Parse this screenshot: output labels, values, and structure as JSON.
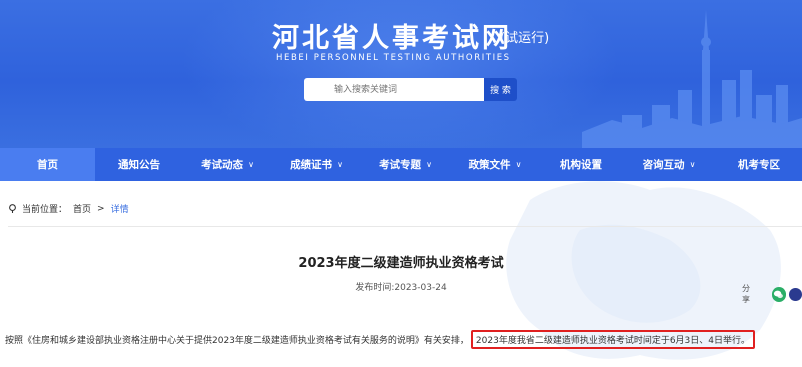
{
  "header": {
    "title": "河北省人事考试网",
    "title_suffix": "(试运行)",
    "subtitle_en": "HEBEI PERSONNEL TESTING AUTHORITIES"
  },
  "search": {
    "placeholder": "输入搜索关键词",
    "button_label": "搜 索"
  },
  "nav": {
    "items": [
      {
        "label": "首页",
        "has_dropdown": false,
        "active": true
      },
      {
        "label": "通知公告",
        "has_dropdown": false,
        "active": false
      },
      {
        "label": "考试动态",
        "has_dropdown": true,
        "active": false
      },
      {
        "label": "成绩证书",
        "has_dropdown": true,
        "active": false
      },
      {
        "label": "考试专题",
        "has_dropdown": true,
        "active": false
      },
      {
        "label": "政策文件",
        "has_dropdown": true,
        "active": false
      },
      {
        "label": "机构设置",
        "has_dropdown": false,
        "active": false
      },
      {
        "label": "咨询互动",
        "has_dropdown": true,
        "active": false
      },
      {
        "label": "机考专区",
        "has_dropdown": false,
        "active": false
      }
    ]
  },
  "breadcrumb": {
    "prefix": "当前位置：",
    "home": "首页",
    "separator": ">",
    "current": "详情"
  },
  "article": {
    "title": "2023年度二级建造师执业资格考试",
    "date": "发布时间:2023-03-24",
    "share_label": "分享",
    "body_prefix": "按照《住房和城乡建设部执业资格注册中心关于提供2023年度二级建造师执业资格考试有关服务的说明》有关安排，",
    "body_highlight": "2023年度我省二级建造师执业资格考试时间定于6月3日、4日举行。"
  },
  "colors": {
    "banner": "#2f62dc",
    "nav": "#2f62e0",
    "nav_active": "#4a7df0",
    "highlight_border": "#e02020",
    "wechat": "#2aae67"
  },
  "icons": {
    "location": "location-icon",
    "wechat": "wechat-icon",
    "weibo": "weibo-icon",
    "dropdown": "chevron-down-icon"
  }
}
